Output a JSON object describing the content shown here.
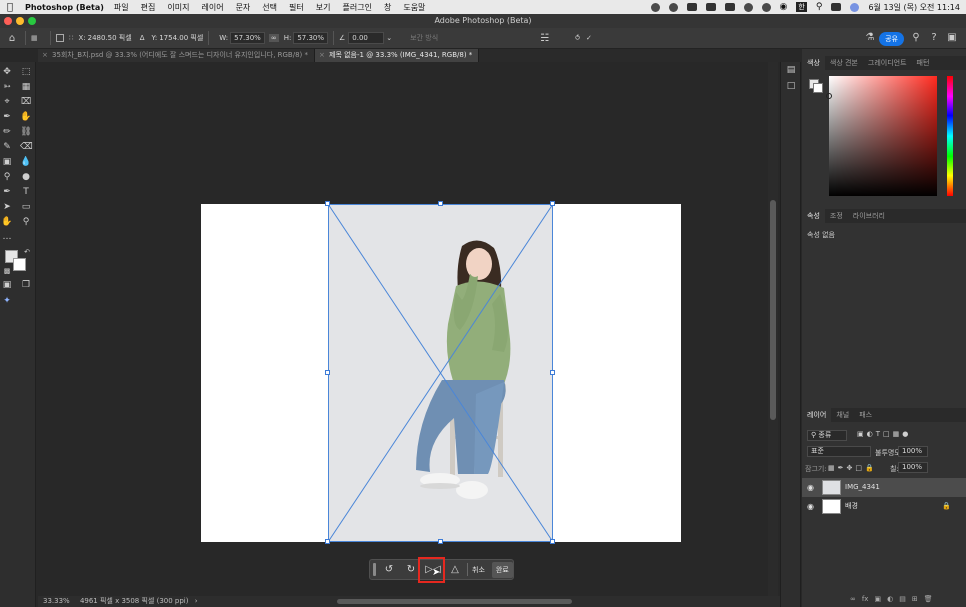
{
  "menubar": {
    "apple_icon": "apple-icon",
    "app_name": "Photoshop (Beta)",
    "items": [
      "파일",
      "편집",
      "이미지",
      "레이어",
      "문자",
      "선택",
      "필터",
      "보기",
      "플러그인",
      "창",
      "도움말"
    ],
    "clock": "6월 13일 (목) 오전 11:14",
    "input_source": "한"
  },
  "window": {
    "title": "Adobe Photoshop (Beta)"
  },
  "options": {
    "x_label": "X:",
    "x_value": "2480.50 픽셀",
    "y_label": "Y:",
    "y_value": "1754.00 픽셀",
    "w_label": "W:",
    "w_value": "57.30%",
    "h_label": "H:",
    "h_value": "57.30%",
    "angle_value": "0.00",
    "interp_label": "보간 방식",
    "share_label": "공유"
  },
  "tabs": [
    {
      "label": "35회차_B지.psd @ 33.3% (어디에도 잘 스며드는 디자이너 유지인입니다, RGB/8) *",
      "active": false
    },
    {
      "label": "제목 없음-1 @ 33.3% (IMG_4341, RGB/8) *",
      "active": true
    }
  ],
  "taskbar": {
    "cancel_label": "취소",
    "done_label": "완료"
  },
  "status": {
    "zoom": "33.33%",
    "doc_info": "4961 픽셀 x 3508 픽셀 (300 ppi)"
  },
  "color_panel": {
    "tabs": [
      "색상",
      "색상 견본",
      "그레이디언트",
      "패턴"
    ]
  },
  "properties_panel": {
    "tabs": [
      "속성",
      "조정",
      "라이브러리"
    ],
    "empty_text": "속성 없음"
  },
  "layers_panel": {
    "tabs": [
      "레이어",
      "채널",
      "패스"
    ],
    "search_placeholder": "종류",
    "blend_mode": "표준",
    "opacity_label": "불투명도:",
    "opacity_value": "100%",
    "lock_label": "잠그기:",
    "fill_label": "칠:",
    "fill_value": "100%",
    "layers": [
      {
        "name": "IMG_4341",
        "selected": true
      },
      {
        "name": "배경",
        "selected": false
      }
    ]
  },
  "colors": {
    "accent": "#1473e6",
    "highlight": "#e5281f",
    "transform_line": "#4a86d8"
  }
}
